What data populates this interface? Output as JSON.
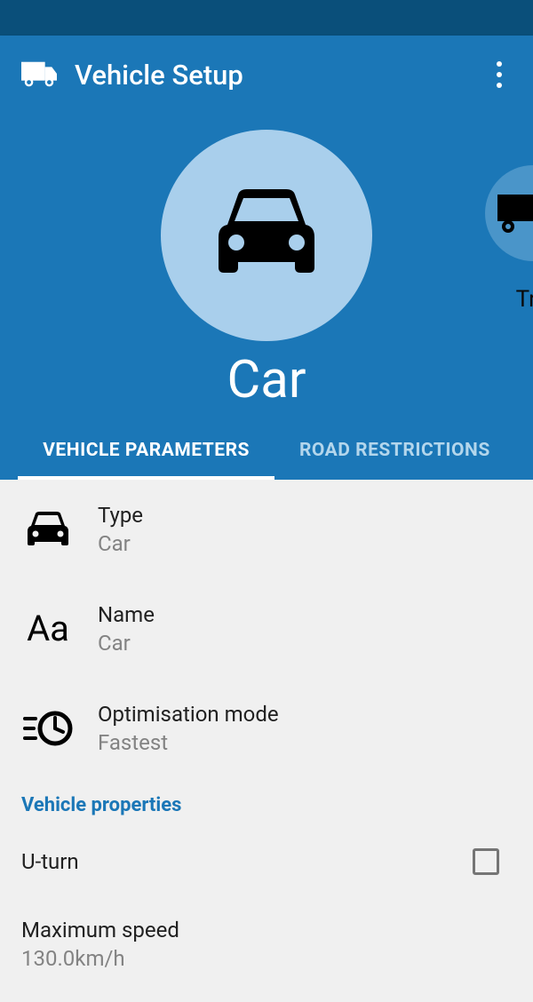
{
  "appbar": {
    "title": "Vehicle Setup"
  },
  "hero": {
    "selected_vehicle": "Car",
    "next_vehicle_partial": "Tr"
  },
  "tabs": [
    {
      "label": "VEHICLE PARAMETERS",
      "active": true
    },
    {
      "label": "ROAD RESTRICTIONS",
      "active": false
    }
  ],
  "params": {
    "type": {
      "label": "Type",
      "value": "Car"
    },
    "name": {
      "label": "Name",
      "value": "Car"
    },
    "optimisation": {
      "label": "Optimisation mode",
      "value": "Fastest"
    }
  },
  "section_header": "Vehicle properties",
  "uturn": {
    "label": "U-turn",
    "checked": false
  },
  "max_speed": {
    "label": "Maximum speed",
    "value": "130.0km/h"
  }
}
